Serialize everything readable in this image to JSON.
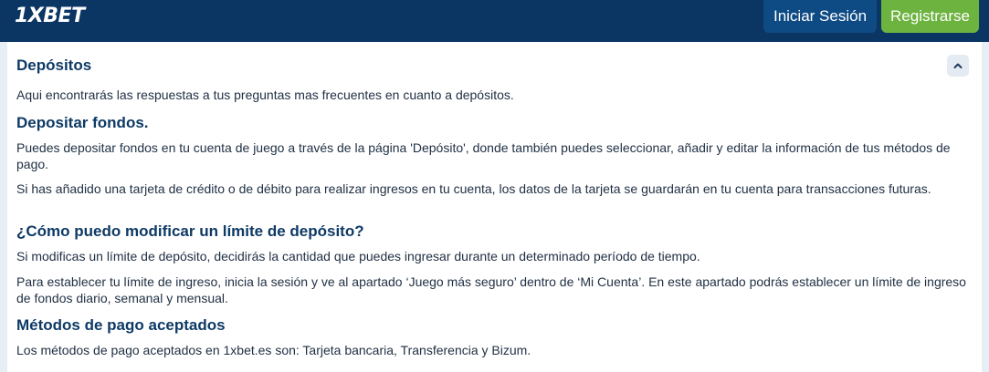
{
  "header": {
    "logo": "1XBET",
    "login_label": "Iniciar Sesión",
    "register_label": "Registrarse"
  },
  "faq": {
    "section_title": "Depósitos",
    "intro": "Aqui encontrarás las respuestas a tus preguntas mas frecuentes en cuanto a depósitos.",
    "q1_title": "Depositar fondos.",
    "q1_p1": "Puedes depositar fondos en tu cuenta de juego a través de la página 'Depósito', donde también puedes seleccionar, añadir y editar la información de tus métodos de pago.",
    "q1_p2": "Si has añadido una tarjeta de crédito o de débito para realizar ingresos en tu cuenta, los datos de la tarjeta se guardarán en tu cuenta para transacciones futuras.",
    "q2_title": "¿Cómo puedo modificar un límite de depósito?",
    "q2_p1": "Si modificas un límite de depósito, decidirás la cantidad que puedes ingresar durante un determinado período de tiempo.",
    "q2_p2": "Para establecer tu límite de ingreso, inicia la sesión y ve al apartado ‘Juego más seguro’ dentro de ‘Mi Cuenta’. En este apartado podrás establecer un límite de ingreso de fondos diario, semanal y mensual.",
    "q3_title": "Métodos de pago aceptados",
    "q3_p1": "Los métodos de pago aceptados en 1xbet.es son: Tarjeta bancaria, Transferencia y Bizum."
  },
  "icons": {
    "collapse": "chevron-up-icon"
  },
  "colors": {
    "header_bg": "#0b3563",
    "login_bg": "#0e4a84",
    "register_bg": "#6db33f",
    "heading": "#0e3a66"
  }
}
